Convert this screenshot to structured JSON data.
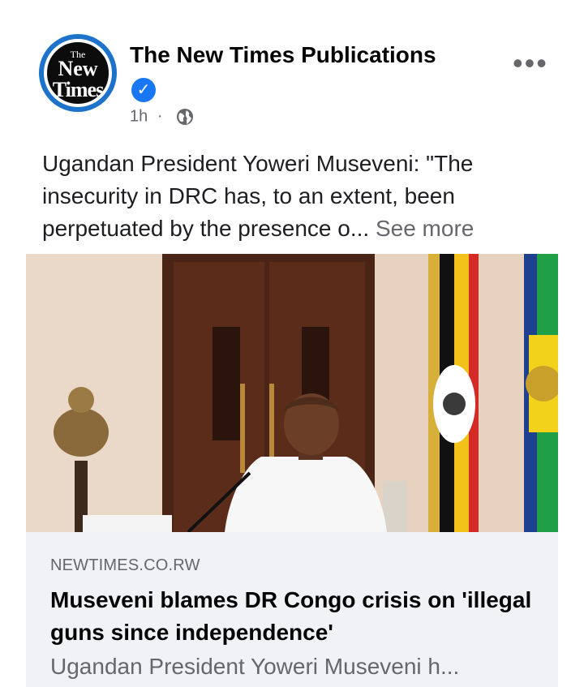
{
  "post": {
    "page_name": "The New Times Publications",
    "avatar_logo": {
      "line1": "The",
      "line2": "New",
      "line3": "Times"
    },
    "time": "1h",
    "separator": "·",
    "privacy_icon": "globe-icon",
    "more_options": "•••",
    "caption": "Ugandan President Yoweri Museveni: \"The insecurity in DRC has, to an extent, been perpetuated by the presence o...",
    "see_more": "See more"
  },
  "link_preview": {
    "domain": "NEWTIMES.CO.RW",
    "headline": "Museveni blames DR Congo crisis on 'illegal guns since independence'",
    "description": "Ugandan President Yoweri Museveni h..."
  },
  "colors": {
    "verified": "#1877f2",
    "secondary_text": "#65676b",
    "card_bg": "#f0f2f5"
  }
}
